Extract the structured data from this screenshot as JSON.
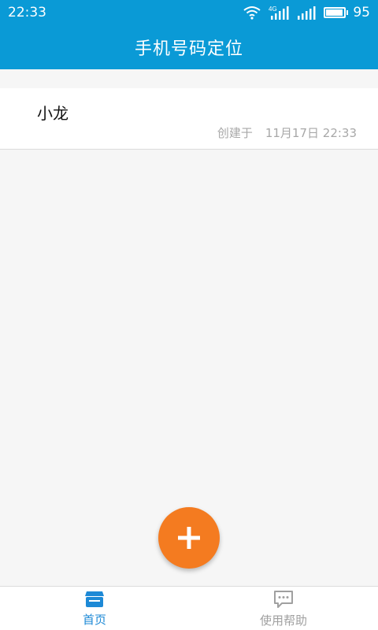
{
  "status_bar": {
    "time": "22:33",
    "network_label": "4G",
    "battery_percent": "95",
    "battery_level": 0.95
  },
  "header": {
    "title": "手机号码定位"
  },
  "contacts": [
    {
      "name": "小龙",
      "created_label": "创建于",
      "created_time": "11月17日 22:33"
    }
  ],
  "fab": {
    "icon": "plus-icon",
    "color": "#f47b20"
  },
  "bottom_nav": {
    "items": [
      {
        "label": "首页",
        "icon": "store-icon",
        "active": true
      },
      {
        "label": "使用帮助",
        "icon": "chat-bubble-icon",
        "active": false
      }
    ]
  },
  "colors": {
    "primary": "#0a9ad6",
    "accent": "#f47b20",
    "active_nav": "#1d89d6",
    "inactive_nav": "#a0a0a0"
  }
}
